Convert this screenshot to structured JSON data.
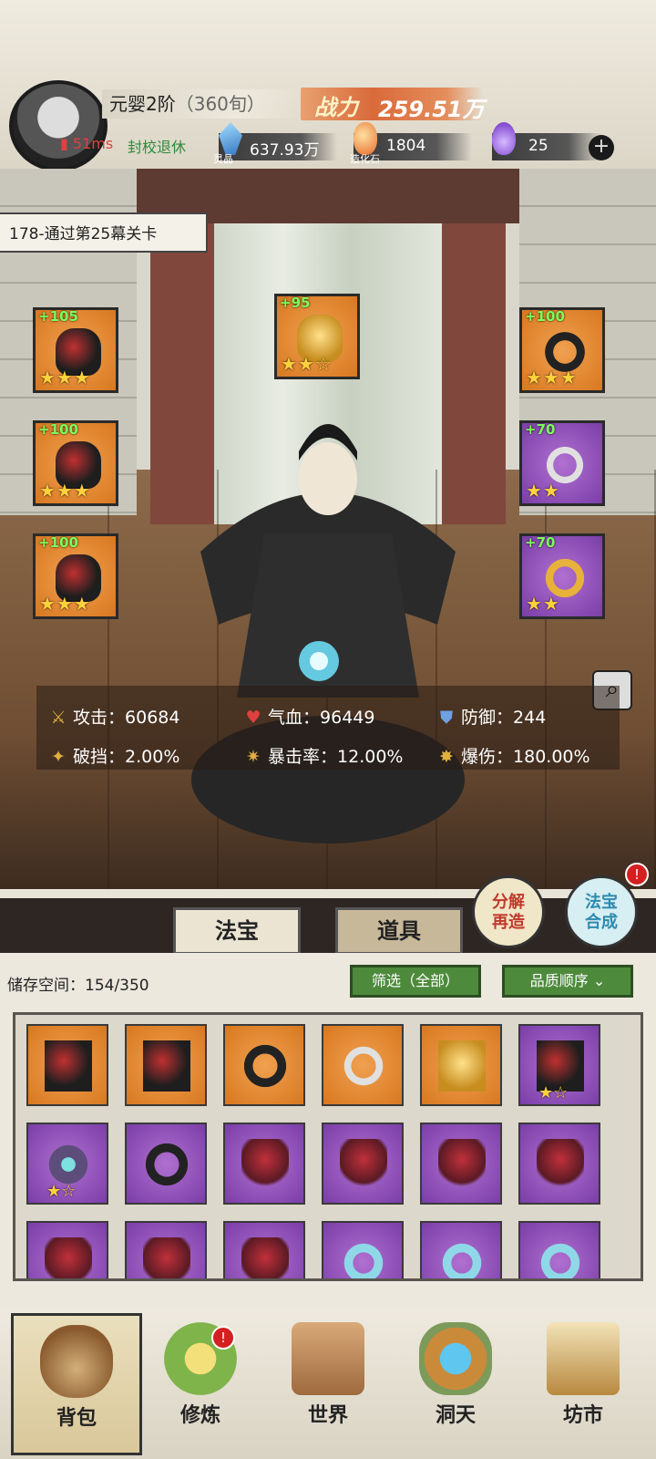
{
  "player": {
    "realm": "元婴2阶",
    "realm_sub": "（360旬）",
    "ping": "51ms",
    "status_text": "封校退休"
  },
  "power": {
    "label": "战力",
    "value": "259.51万"
  },
  "resources": [
    {
      "name": "灵晶",
      "value": "637.93万",
      "icon": "blue-crystal-icon",
      "color": "#5fa7d9"
    },
    {
      "name": "造化石",
      "value": "1804",
      "icon": "orange-stone-icon",
      "color": "#e58b3a"
    },
    {
      "name": "",
      "value": "25",
      "icon": "purple-flame-icon",
      "color": "#8b4ad0"
    }
  ],
  "stage_banner": "178-通过第25幕关卡",
  "equipped": [
    {
      "level": "+105",
      "stars": "★★★",
      "quality": "orange",
      "icon": "dark-gauntlet-icon"
    },
    {
      "level": "+95",
      "stars": "★★☆",
      "quality": "orange",
      "icon": "golden-dragon-icon"
    },
    {
      "level": "+100",
      "stars": "★★★",
      "quality": "orange",
      "icon": "ring-icon"
    },
    {
      "level": "+100",
      "stars": "★★★",
      "quality": "orange",
      "icon": "robe-icon"
    },
    {
      "level": "+70",
      "stars": "★★",
      "quality": "purple",
      "icon": "silver-pendant-icon"
    },
    {
      "level": "+100",
      "stars": "★★★",
      "quality": "orange",
      "icon": "boots-icon"
    },
    {
      "level": "+70",
      "stars": "★★",
      "quality": "purple",
      "icon": "gold-ring-icon"
    }
  ],
  "stats": {
    "attack_label": "攻击：",
    "attack": "60684",
    "hp_label": "气血：",
    "hp": "96449",
    "defense_label": "防御：",
    "defense": "244",
    "pierce_label": "破挡：",
    "pierce": "2.00%",
    "crit_label": "暴击率：",
    "crit": "12.00%",
    "critdmg_label": "爆伤：",
    "critdmg": "180.00%"
  },
  "actions": {
    "decompose": "分解再造",
    "synthesize": "法宝合成",
    "badge": "!"
  },
  "tabs": {
    "fabao": "法宝",
    "daoju": "道具"
  },
  "inventory": {
    "storage_label": "储存空间：",
    "storage_value": "154/350",
    "filter": "筛选（全部）",
    "sort": "品质顺序"
  },
  "items": [
    {
      "quality": "orange",
      "icon": "robe-icon",
      "stars": ""
    },
    {
      "quality": "orange",
      "icon": "boots-icon",
      "stars": ""
    },
    {
      "quality": "orange",
      "icon": "ring-icon",
      "stars": ""
    },
    {
      "quality": "orange",
      "icon": "pendant-icon",
      "stars": ""
    },
    {
      "quality": "orange",
      "icon": "golden-dragon-icon",
      "stars": ""
    },
    {
      "quality": "purple",
      "icon": "boots-icon",
      "stars": "★☆"
    },
    {
      "quality": "purple",
      "icon": "jade-ring-icon",
      "stars": "★☆"
    },
    {
      "quality": "purple",
      "icon": "ring-icon",
      "stars": ""
    },
    {
      "quality": "purple",
      "icon": "red-vest-icon",
      "stars": ""
    },
    {
      "quality": "purple",
      "icon": "red-vest-icon",
      "stars": ""
    },
    {
      "quality": "purple",
      "icon": "red-vest-icon",
      "stars": ""
    },
    {
      "quality": "purple",
      "icon": "red-vest-icon",
      "stars": ""
    },
    {
      "quality": "purple",
      "icon": "red-vest-icon",
      "stars": ""
    },
    {
      "quality": "purple",
      "icon": "red-vest-icon",
      "stars": ""
    },
    {
      "quality": "purple",
      "icon": "red-vest-icon",
      "stars": ""
    },
    {
      "quality": "purple",
      "icon": "blue-bracelet-icon",
      "stars": ""
    },
    {
      "quality": "purple",
      "icon": "blue-bracelet-icon",
      "stars": ""
    },
    {
      "quality": "purple",
      "icon": "blue-bracelet-icon",
      "stars": ""
    }
  ],
  "nav": [
    {
      "label": "背包",
      "icon": "bag-icon"
    },
    {
      "label": "修炼",
      "icon": "lotus-icon"
    },
    {
      "label": "世界",
      "icon": "scroll-map-icon"
    },
    {
      "label": "洞天",
      "icon": "portal-icon"
    },
    {
      "label": "坊市",
      "icon": "market-icon"
    }
  ]
}
